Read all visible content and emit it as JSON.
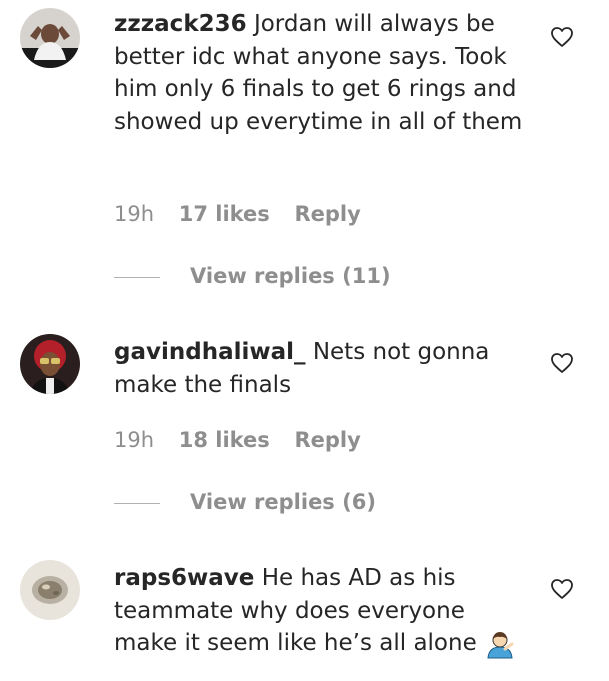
{
  "comments": [
    {
      "username": "zzzack236",
      "text": "Jordan will always be better idc what anyone says. Took him only 6 finals to get 6 rings and showed up everytime in all of them",
      "time": "19h",
      "likes": "17 likes",
      "reply": "Reply",
      "view_replies": "View replies (11)"
    },
    {
      "username": "gavindhaliwal_",
      "text": "Nets not gonna make the finals",
      "time": "19h",
      "likes": "18 likes",
      "reply": "Reply",
      "view_replies": "View replies (6)"
    },
    {
      "username": "raps6wave",
      "text": "He has AD as his teammate why does everyone make it seem like he’s all alone",
      "emoji": "person-shrugging-emoji"
    }
  ],
  "icons": {
    "like": "heart-outline-icon"
  },
  "colors": {
    "text": "#262626",
    "secondary": "#8e8e8e",
    "divider": "#b0b0b0"
  }
}
